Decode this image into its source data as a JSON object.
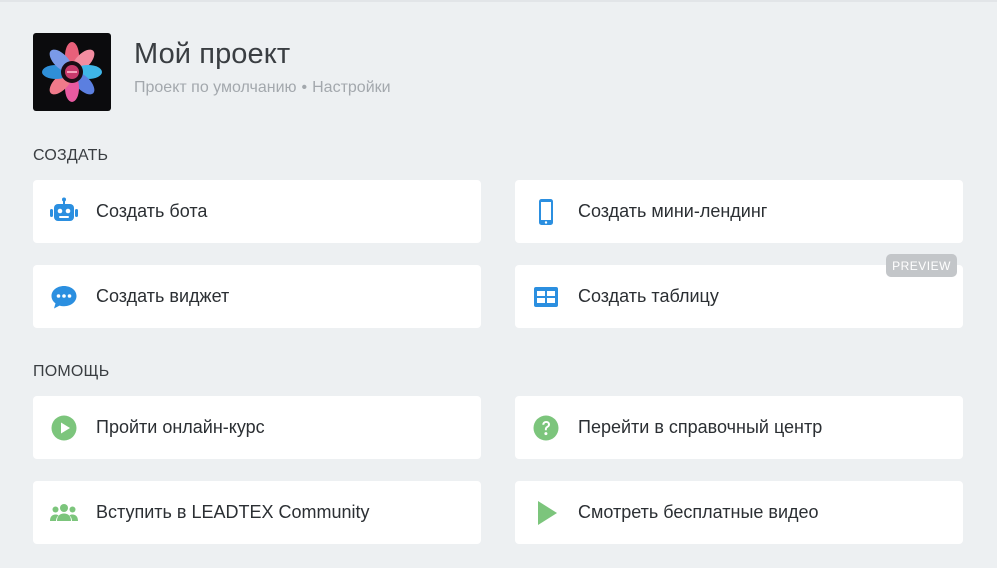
{
  "header": {
    "title": "Мой проект",
    "breadcrumb": {
      "project": "Проект по умолчанию",
      "separator": "•",
      "settings": "Настройки"
    }
  },
  "sections": {
    "create": {
      "title": "СОЗДАТЬ",
      "items": [
        {
          "label": "Создать бота",
          "icon": "robot-icon"
        },
        {
          "label": "Создать мини-лендинг",
          "icon": "smartphone-icon"
        },
        {
          "label": "Создать виджет",
          "icon": "chat-bubble-icon"
        },
        {
          "label": "Создать таблицу",
          "icon": "table-icon",
          "badge": "PREVIEW"
        }
      ]
    },
    "help": {
      "title": "ПОМОЩЬ",
      "items": [
        {
          "label": "Пройти онлайн-курс",
          "icon": "play-circle-icon"
        },
        {
          "label": "Перейти в справочный центр",
          "icon": "question-circle-icon"
        },
        {
          "label": "Вступить в LEADTEX Community",
          "icon": "group-icon"
        },
        {
          "label": "Смотреть бесплатные видео",
          "icon": "play-triangle-icon"
        }
      ]
    }
  },
  "colors": {
    "background": "#edf0f2",
    "card": "#ffffff",
    "blue_icon": "#2b8fe0",
    "green_icon": "#7cc57c",
    "badge": "#c3c6c9"
  }
}
